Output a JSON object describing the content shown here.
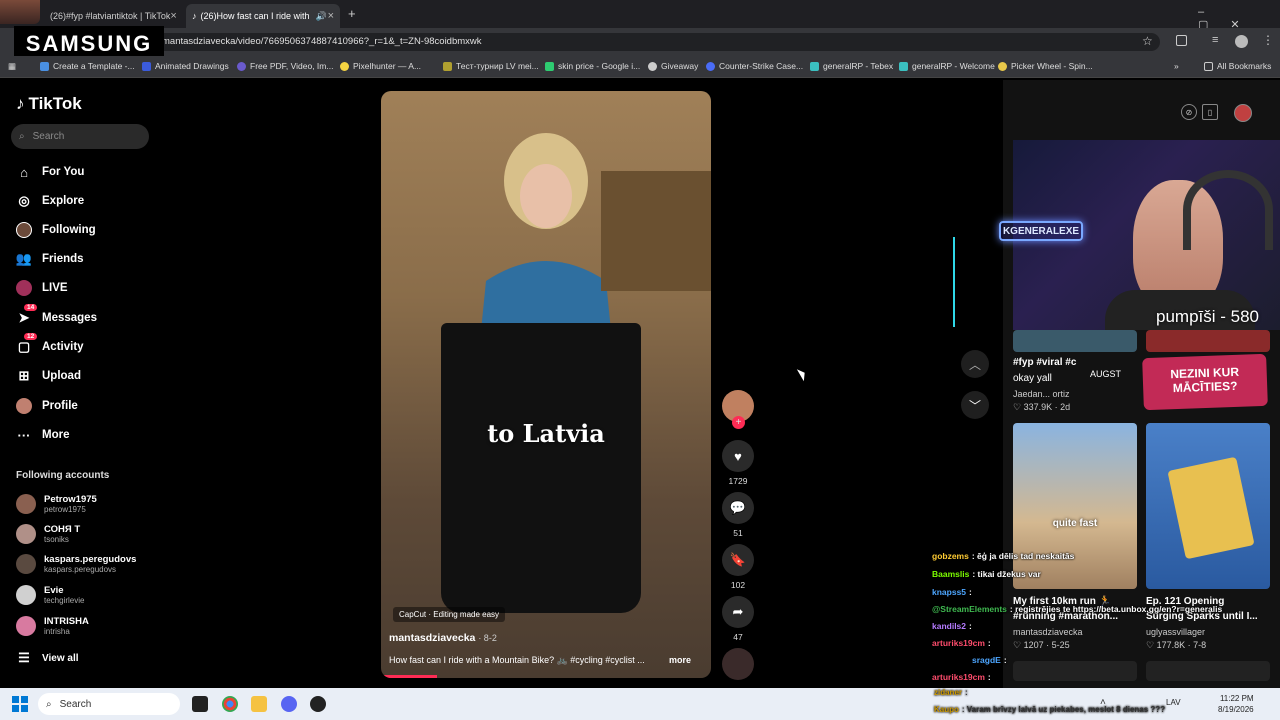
{
  "browser": {
    "tabs": [
      {
        "title": "(26)#fyp #latviantiktok | TikTok"
      },
      {
        "title": "(26)How fast can I ride with"
      }
    ],
    "new_tab": "+",
    "url": "mantasdziavecka/video/7669506374887410966?_r=1&_t=ZN-98coidbmxwk",
    "bookmarks": [
      "Create a Template -...",
      "Animated Drawings",
      "Free PDF, Video, Im...",
      "Pixelhunter — A...",
      "Тест-турнир LV mei...",
      "skin price - Google i...",
      "Giveaway",
      "Counter-Strike Case...",
      "generalRP - Tebex",
      "generalRP - Welcome",
      "Picker Wheel - Spin..."
    ],
    "all_bookmarks": "All Bookmarks",
    "brand_overlay": "SAMSUNG"
  },
  "sidebar": {
    "logo": "TikTok",
    "search_placeholder": "Search",
    "nav": [
      {
        "label": "For You",
        "icon": "home-icon"
      },
      {
        "label": "Explore",
        "icon": "compass-icon"
      },
      {
        "label": "Following",
        "icon": "following-avatar-icon"
      },
      {
        "label": "Friends",
        "icon": "friends-icon"
      },
      {
        "label": "LIVE",
        "icon": "live-icon"
      },
      {
        "label": "Messages",
        "icon": "messages-icon",
        "badge": "14"
      },
      {
        "label": "Activity",
        "icon": "activity-icon",
        "badge": "12"
      },
      {
        "label": "Upload",
        "icon": "upload-icon"
      },
      {
        "label": "Profile",
        "icon": "profile-avatar-icon"
      },
      {
        "label": "More",
        "icon": "more-icon"
      }
    ],
    "following_header": "Following accounts",
    "accounts": [
      {
        "name": "Petrow1975",
        "handle": "petrow1975"
      },
      {
        "name": "СОНЯ Т",
        "handle": "tsoniks"
      },
      {
        "name": "kaspars.peregudovs",
        "handle": "kaspars.peregudovs"
      },
      {
        "name": "Evie",
        "handle": "techgirlevie"
      },
      {
        "name": "INTRISHA",
        "handle": "intrisha"
      }
    ],
    "view_all": "View all"
  },
  "video": {
    "overlay_text": "to Latvia",
    "capcut": "CapCut · Editing made easy",
    "author": "mantasdziavecka",
    "date": "· 8-2",
    "description": "How fast can I ride with a Mountain Bike? 🚲 #cycling #cyclist ...",
    "more": "more",
    "progress_fraction": 0.17
  },
  "actions": {
    "likes": "1729",
    "comments": "51",
    "saves": "102",
    "shares": "47"
  },
  "stream": {
    "neon_sign": "KGENERALEXE",
    "counter_text": "pumpīši - 580",
    "banner_top": "AUGST",
    "banner": "NEZINI KUR MĀCĪTIES?"
  },
  "grid": {
    "card1": {
      "title": "#fyp #viral #c",
      "sub1": "okay yall",
      "author": "Jaedan... ortiz",
      "stats": "♡ 337.9K · 2d"
    },
    "card3": {
      "overlay": "quite fast",
      "title": "My first 10km run 🏃",
      "title2": "#running #marathon...",
      "author": "mantasdziavecka",
      "stats": "♡ 1207 · 5-25"
    },
    "card4": {
      "title": "Ep. 121 Opening",
      "title2": "Surging Sparks until I...",
      "author": "uglyassvillager",
      "stats": "♡ 177.8K · 7-8"
    }
  },
  "chat": [
    {
      "user": "gobzems",
      "msg": ": ēģ ja dēlis tad neskaitās",
      "color": "#ffcc33"
    },
    {
      "user": "Baamslis",
      "msg": ": tikai džekus var",
      "color": "#7cfc00"
    },
    {
      "user": "knapss5",
      "msg": ":",
      "color": "#4da6ff"
    },
    {
      "user": "@StreamElements",
      "msg": ": registrējies te https://beta.unbox.gg/en?r=generalis",
      "color": "#3fb950"
    },
    {
      "user": "kandils2",
      "msg": ":",
      "color": "#b57bff"
    },
    {
      "user": "arturiks19cm",
      "msg": ":",
      "color": "#ff4d6d"
    },
    {
      "user": "sragdE",
      "msg": ":",
      "color": "#4da6ff"
    },
    {
      "user": "arturiks19cm",
      "msg": ":",
      "color": "#ff4d6d"
    },
    {
      "user": "zidaner",
      "msg": ":",
      "color": "#ffcc33"
    },
    {
      "user": "Kaupo",
      "msg": ": Varam brīvzy lalvā uz piekabes, meslot 8 dienas ???",
      "color": "#ffcc33"
    }
  ],
  "taskbar": {
    "search": "Search",
    "lang": "LAV",
    "time": "11:22 PM",
    "date": "8/19/2026"
  }
}
